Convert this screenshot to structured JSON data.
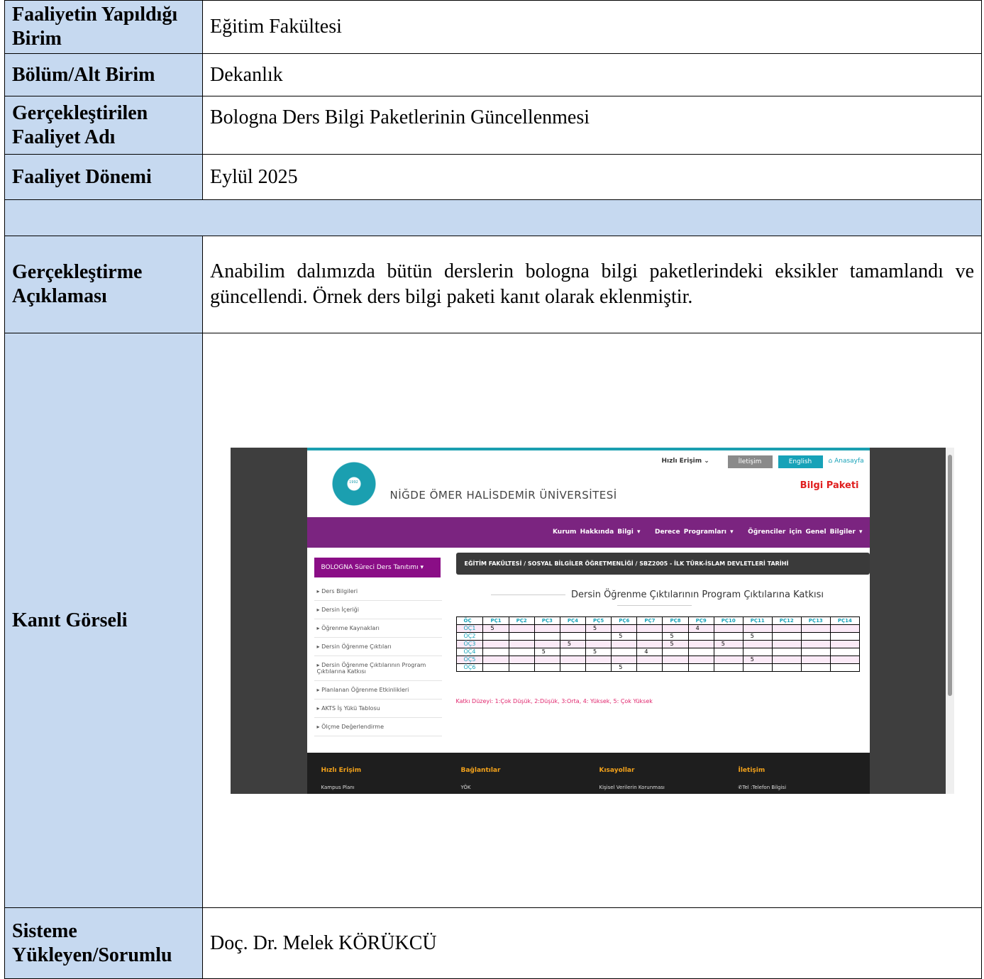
{
  "rows": {
    "unit": {
      "label": "Faaliyetin Yapıldığı Birim",
      "value": "Eğitim Fakültesi"
    },
    "dept": {
      "label": "Bölüm/Alt Birim",
      "value": "Dekanlık"
    },
    "activity": {
      "label": "Gerçekleştirilen Faaliyet Adı",
      "value": "Bologna Ders Bilgi Paketlerinin Güncellenmesi"
    },
    "period": {
      "label": "Faaliyet Dönemi",
      "value": "Eylül 2025"
    },
    "description": {
      "label": "Gerçekleştirme Açıklaması",
      "value": "Anabilim dalımızda bütün derslerin bologna bilgi paketlerindeki eksikler tamamlandı ve güncellendi. Örnek ders bilgi paketi kanıt olarak eklenmiştir."
    },
    "evidence": {
      "label": "Kanıt Görseli"
    },
    "uploader": {
      "label": "Sisteme Yükleyen/Sorumlu",
      "value": "Doç. Dr. Melek KÖRÜKCÜ"
    }
  },
  "screenshot": {
    "quick_access": "Hızlı Erişim",
    "contact_btn": "İletişim",
    "english_btn": "English",
    "home_link": "Anasayfa",
    "logo_year": "1992",
    "university": "NİĞDE ÖMER HALİSDEMİR ÜNİVERSİTESİ",
    "page_title": "Bilgi Paketi",
    "menu": [
      "Kurum Hakkında Bilgi ▾",
      "Derece Programları ▾",
      "Öğrenciler için Genel Bilgiler ▾"
    ],
    "side_button": "BOLOGNA Süreci Ders Tanıtımı ▾",
    "side_items": [
      "Ders Bilgileri",
      "Dersin İçeriği",
      "Öğrenme Kaynakları",
      "Dersin Öğrenme Çıktıları",
      "Dersin Öğrenme Çıktılarının Program Çıktılarına Katkısı",
      "Planlanan Öğrenme Etkinlikleri",
      "AKTS İş Yükü Tablosu",
      "Ölçme Değerlendirme"
    ],
    "breadcrumb": "EĞİTİM FAKÜLTESİ / SOSYAL BİLGİLER ÖĞRETMENLİĞİ / SBZ2005 - İLK TÜRK-İSLAM DEVLETLERİ TARİHİ",
    "matrix_title": "Dersin Öğrenme Çıktılarının Program Çıktılarına Katkısı",
    "matrix_header": [
      "ÖÇ",
      "PÇ1",
      "PÇ2",
      "PÇ3",
      "PÇ4",
      "PÇ5",
      "PÇ6",
      "PÇ7",
      "PÇ8",
      "PÇ9",
      "PÇ10",
      "PÇ11",
      "PÇ12",
      "PÇ13",
      "PÇ14"
    ],
    "matrix_rows": [
      [
        "ÖÇ1",
        "5",
        "",
        "",
        "",
        "5",
        "",
        "",
        "",
        "4",
        "",
        "",
        "",
        "",
        ""
      ],
      [
        "ÖÇ2",
        "",
        "",
        "",
        "",
        "",
        "5",
        "",
        "5",
        "",
        "",
        "5",
        "",
        "",
        ""
      ],
      [
        "ÖÇ3",
        "",
        "",
        "",
        "5",
        "",
        "",
        "",
        "5",
        "",
        "5",
        "",
        "",
        "",
        ""
      ],
      [
        "ÖÇ4",
        "",
        "",
        "5",
        "",
        "5",
        "",
        "4",
        "",
        "",
        "",
        "",
        "",
        "",
        ""
      ],
      [
        "ÖÇ5",
        "",
        "",
        "",
        "",
        "",
        "",
        "",
        "",
        "",
        "",
        "5",
        "",
        "",
        ""
      ],
      [
        "ÖÇ6",
        "",
        "",
        "",
        "",
        "",
        "5",
        "",
        "",
        "",
        "",
        "",
        "",
        "",
        ""
      ]
    ],
    "legend": "Katkı Düzeyi: 1:Çok Düşük, 2:Düşük, 3:Orta, 4: Yüksek, 5: Çok Yüksek",
    "footer": {
      "heads": [
        "Hızlı Erişim",
        "Bağlantılar",
        "Kısayollar",
        "İletişim"
      ],
      "items": [
        "Kampus Planı",
        "YÖK",
        "Kişisel Verilerin Korunması",
        "Tel :Telefon Bilgisi"
      ]
    }
  }
}
